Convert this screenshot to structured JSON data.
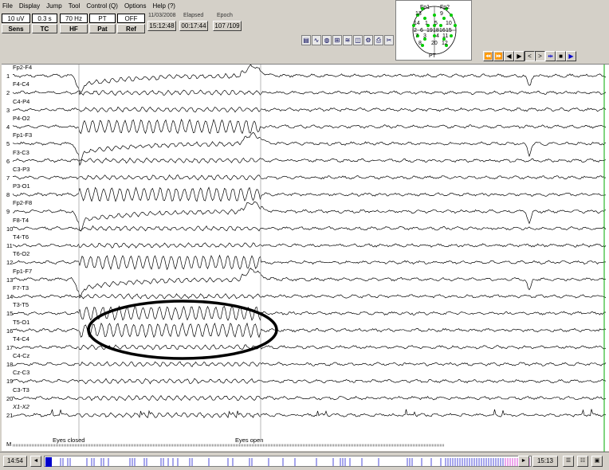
{
  "menu": [
    "File",
    "Display",
    "Jump",
    "Tool",
    "Control (Q)",
    "Options",
    "Help (?)"
  ],
  "controls": {
    "sens_value": "10 uV",
    "sens_label": "Sens",
    "tc_value": "0.3 s",
    "tc_label": "TC",
    "hf_value": "70 Hz",
    "hf_label": "HF",
    "pat_value": "PT",
    "pat_label": "Pat",
    "ref_value": "OFF",
    "ref_label": "Ref"
  },
  "date": "11/03/2008",
  "clock_time": "15:12:48",
  "elapsed_label": "Elapsed",
  "elapsed_time": "00:17:44",
  "epoch_label": "Epoch",
  "epoch_value": "107 /109",
  "toolbar_icons": [
    "save-icon",
    "waveform-icon",
    "globe-icon",
    "montage-icon",
    "spectrum-icon",
    "camera-icon",
    "settings-icon",
    "print-icon",
    "cut-icon"
  ],
  "montage": {
    "electrodes": [
      "Fp1",
      "Fp2"
    ],
    "numbers": [
      "13",
      "9",
      "14",
      "5",
      "1",
      "10",
      "2",
      "6",
      "19",
      "18",
      "16",
      "15",
      "7",
      "3",
      "11",
      "4",
      "8",
      "12",
      "20"
    ],
    "footer": "PT"
  },
  "nav_buttons": [
    "⏪",
    "⏩",
    "◀",
    "▶",
    "<",
    ">",
    "⇹",
    "■",
    "▶"
  ],
  "channels": [
    {
      "num": "1",
      "label": "Fp2-F4"
    },
    {
      "num": "2",
      "label": "F4-C4"
    },
    {
      "num": "3",
      "label": "C4-P4"
    },
    {
      "num": "4",
      "label": "P4-O2"
    },
    {
      "num": "5",
      "label": "Fp1-F3"
    },
    {
      "num": "6",
      "label": "F3-C3"
    },
    {
      "num": "7",
      "label": "C3-P3"
    },
    {
      "num": "8",
      "label": "P3-O1"
    },
    {
      "num": "9",
      "label": "Fp2-F8"
    },
    {
      "num": "10",
      "label": "F8-T4"
    },
    {
      "num": "11",
      "label": "T4-T6"
    },
    {
      "num": "12",
      "label": "T6-O2"
    },
    {
      "num": "13",
      "label": "Fp1-F7"
    },
    {
      "num": "14",
      "label": "F7-T3"
    },
    {
      "num": "15",
      "label": "T3-T5"
    },
    {
      "num": "16",
      "label": "T5-O1"
    },
    {
      "num": "17",
      "label": "T4-C4"
    },
    {
      "num": "18",
      "label": "C4-Cz"
    },
    {
      "num": "19",
      "label": "Cz-C3"
    },
    {
      "num": "20",
      "label": "C3-T3"
    },
    {
      "num": "21",
      "label": "X1-X2"
    }
  ],
  "marker_row_label": "M",
  "events": {
    "eyes_closed": "Eyes closed",
    "eyes_open": "Eyes open"
  },
  "status": {
    "start_time": "14:54",
    "end_time": "15:13"
  },
  "colors": {
    "trace": "#000000",
    "accent_blue": "#0000cc",
    "montage_dot": "#00cc00",
    "highlight": "#cc00cc"
  }
}
